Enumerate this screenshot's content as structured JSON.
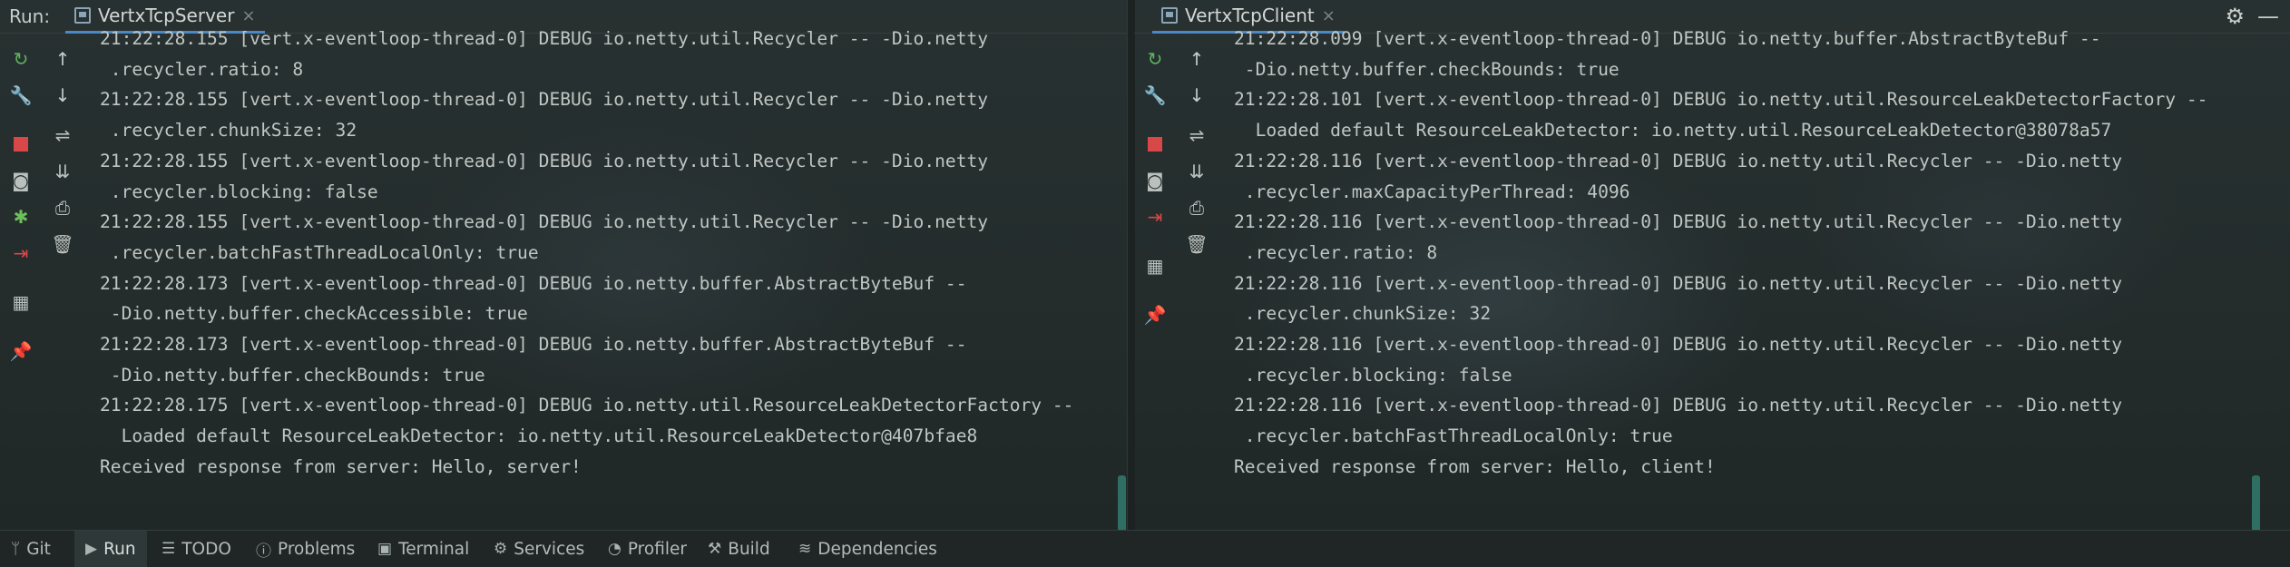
{
  "toolwindow": {
    "run_label": "Run:"
  },
  "tabs": [
    {
      "label": "VertxTcpServer",
      "close": "×"
    },
    {
      "label": "VertxTcpClient",
      "close": "×"
    }
  ],
  "left_toolbar_icons": [
    "rerun-icon",
    "wrench-icon",
    "stop-icon",
    "camera-icon",
    "debug-icon",
    "exit-icon",
    "layout-icon",
    "pin-icon"
  ],
  "console_toolbar_icons": [
    "up-arrow-icon",
    "down-arrow-icon",
    "soft-wrap-icon",
    "scroll-end-icon",
    "print-icon",
    "trash-icon"
  ],
  "server_console": {
    "lines": [
      "21:22:28.155 [vert.x-eventloop-thread-0] DEBUG io.netty.util.Recycler -- -Dio.netty",
      " .recycler.ratio: 8",
      "21:22:28.155 [vert.x-eventloop-thread-0] DEBUG io.netty.util.Recycler -- -Dio.netty",
      " .recycler.chunkSize: 32",
      "21:22:28.155 [vert.x-eventloop-thread-0] DEBUG io.netty.util.Recycler -- -Dio.netty",
      " .recycler.blocking: false",
      "21:22:28.155 [vert.x-eventloop-thread-0] DEBUG io.netty.util.Recycler -- -Dio.netty",
      " .recycler.batchFastThreadLocalOnly: true",
      "21:22:28.173 [vert.x-eventloop-thread-0] DEBUG io.netty.buffer.AbstractByteBuf --",
      " -Dio.netty.buffer.checkAccessible: true",
      "21:22:28.173 [vert.x-eventloop-thread-0] DEBUG io.netty.buffer.AbstractByteBuf --",
      " -Dio.netty.buffer.checkBounds: true",
      "21:22:28.175 [vert.x-eventloop-thread-0] DEBUG io.netty.util.ResourceLeakDetectorFactory --",
      "  Loaded default ResourceLeakDetector: io.netty.util.ResourceLeakDetector@407bfae8",
      "Received response from server: Hello, server!"
    ]
  },
  "client_console": {
    "lines": [
      "21:22:28.099 [vert.x-eventloop-thread-0] DEBUG io.netty.buffer.AbstractByteBuf --",
      " -Dio.netty.buffer.checkBounds: true",
      "21:22:28.101 [vert.x-eventloop-thread-0] DEBUG io.netty.util.ResourceLeakDetectorFactory --",
      "  Loaded default ResourceLeakDetector: io.netty.util.ResourceLeakDetector@38078a57",
      "21:22:28.116 [vert.x-eventloop-thread-0] DEBUG io.netty.util.Recycler -- -Dio.netty",
      " .recycler.maxCapacityPerThread: 4096",
      "21:22:28.116 [vert.x-eventloop-thread-0] DEBUG io.netty.util.Recycler -- -Dio.netty",
      " .recycler.ratio: 8",
      "21:22:28.116 [vert.x-eventloop-thread-0] DEBUG io.netty.util.Recycler -- -Dio.netty",
      " .recycler.chunkSize: 32",
      "21:22:28.116 [vert.x-eventloop-thread-0] DEBUG io.netty.util.Recycler -- -Dio.netty",
      " .recycler.blocking: false",
      "21:22:28.116 [vert.x-eventloop-thread-0] DEBUG io.netty.util.Recycler -- -Dio.netty",
      " .recycler.batchFastThreadLocalOnly: true",
      "Received response from server: Hello, client!"
    ]
  },
  "bottom_bar": [
    {
      "label": "Git",
      "icon": "branch-icon"
    },
    {
      "label": "Run",
      "icon": "run-icon",
      "active": true
    },
    {
      "label": "TODO",
      "icon": "list-icon"
    },
    {
      "label": "Problems",
      "icon": "info-icon"
    },
    {
      "label": "Terminal",
      "icon": "terminal-icon"
    },
    {
      "label": "Services",
      "icon": "services-icon"
    },
    {
      "label": "Profiler",
      "icon": "profiler-icon"
    },
    {
      "label": "Build",
      "icon": "hammer-icon"
    },
    {
      "label": "Dependencies",
      "icon": "layers-icon"
    }
  ],
  "colors": {
    "background": "#232a2a",
    "tab_underline": "#4a88c7",
    "rerun": "#5fb35f",
    "stop": "#d94848",
    "text": "#bfc6c3"
  }
}
